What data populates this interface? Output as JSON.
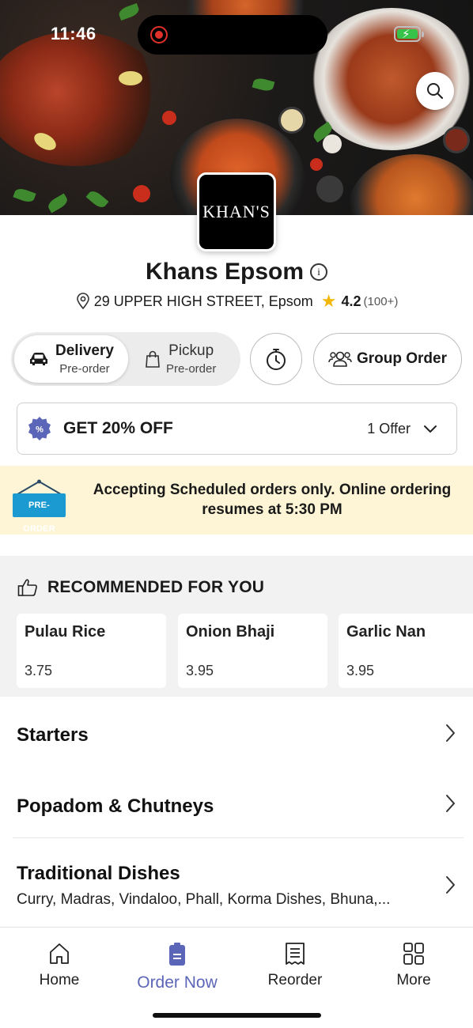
{
  "status_bar": {
    "time": "11:46"
  },
  "restaurant": {
    "logo_text": "KHAN'S",
    "name": "Khans Epsom",
    "address": "29 UPPER HIGH STREET, Epsom",
    "rating": "4.2",
    "rating_count": "(100+)"
  },
  "modes": {
    "delivery": {
      "label": "Delivery",
      "sub": "Pre-order"
    },
    "pickup": {
      "label": "Pickup",
      "sub": "Pre-order"
    }
  },
  "group_order_label": "Group Order",
  "offer": {
    "title": "GET 20% OFF",
    "count": "1 Offer"
  },
  "notice": {
    "badge": "PRE-ORDER",
    "text": "Accepting Scheduled orders only. Online ordering resumes at 5:30 PM"
  },
  "recommended": {
    "title": "RECOMMENDED FOR YOU",
    "items": [
      {
        "name": "Pulau Rice",
        "price": "3.75"
      },
      {
        "name": "Onion Bhaji",
        "price": "3.95"
      },
      {
        "name": "Garlic Nan",
        "price": "3.95"
      }
    ]
  },
  "categories": [
    {
      "name": "Starters",
      "desc": ""
    },
    {
      "name": "Popadom & Chutneys",
      "desc": ""
    },
    {
      "name": "Traditional Dishes",
      "desc": "Curry, Madras, Vindaloo, Phall, Korma Dishes, Bhuna,..."
    }
  ],
  "tabbar": {
    "items": [
      {
        "label": "Home",
        "icon": "home-icon"
      },
      {
        "label": "Order Now",
        "icon": "order-icon"
      },
      {
        "label": "Reorder",
        "icon": "receipt-icon"
      },
      {
        "label": "More",
        "icon": "grid-icon"
      }
    ]
  },
  "colors": {
    "accent": "#5c66b8",
    "notice_bg": "#fdf5d6",
    "rating_star": "#f2b705",
    "preorder_badge": "#1b9ad1"
  }
}
